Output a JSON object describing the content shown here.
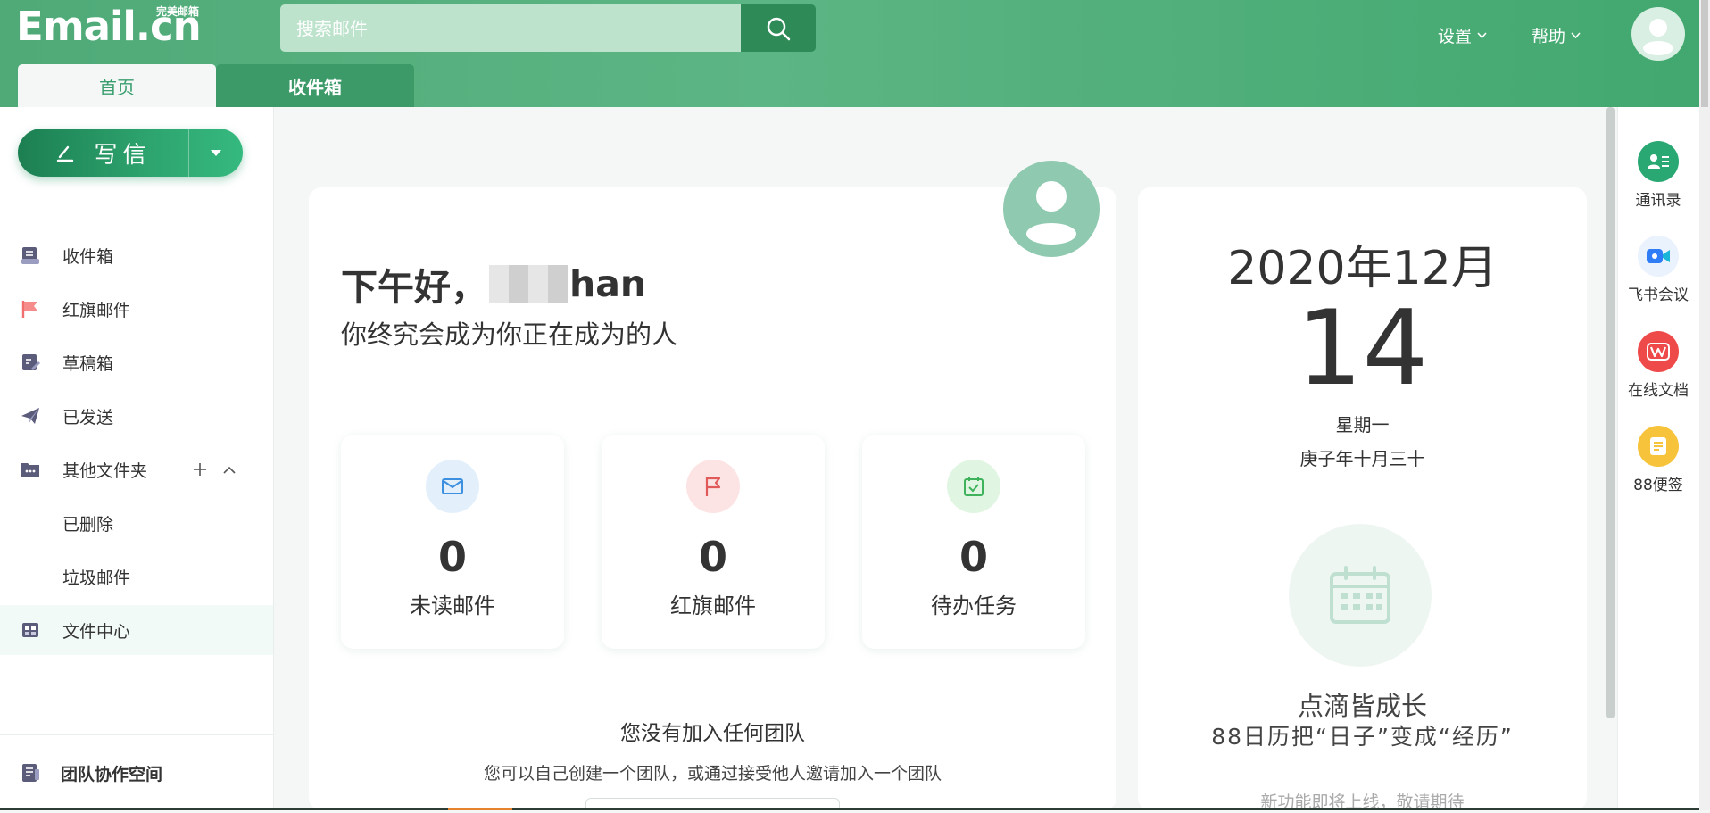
{
  "header": {
    "logo_main": "Email.cn",
    "logo_sub": "完美邮箱",
    "search_placeholder": "搜索邮件",
    "settings_label": "设置",
    "help_label": "帮助",
    "tabs": [
      {
        "label": "首页",
        "active": true
      },
      {
        "label": "收件箱",
        "active": false
      }
    ],
    "colors": {
      "brand": "#4faa78",
      "brand_dark": "#2e8b57"
    }
  },
  "sidebar": {
    "compose_label": "写信",
    "items": [
      {
        "label": "收件箱",
        "icon": "inbox-icon"
      },
      {
        "label": "红旗邮件",
        "icon": "red-flag-icon"
      },
      {
        "label": "草稿箱",
        "icon": "draft-icon"
      },
      {
        "label": "已发送",
        "icon": "send-icon"
      },
      {
        "label": "其他文件夹",
        "icon": "folder-icon"
      },
      {
        "label": "已删除",
        "icon": ""
      },
      {
        "label": "垃圾邮件",
        "icon": ""
      },
      {
        "label": "文件中心",
        "icon": "file-center-icon"
      }
    ],
    "team_space_label": "团队协作空间"
  },
  "main": {
    "greeting_prefix": "下午好，",
    "greeting_suffix": "han",
    "motto": "你终究会成为你正在成为的人",
    "stats": [
      {
        "label": "未读邮件",
        "value": "0",
        "icon": "mail-icon",
        "color": "#3d8fe0",
        "bg": "#e3f0fc"
      },
      {
        "label": "红旗邮件",
        "value": "0",
        "icon": "flag-icon",
        "color": "#e05a5a",
        "bg": "#fde4e4"
      },
      {
        "label": "待办任务",
        "value": "0",
        "icon": "calendar-check-icon",
        "color": "#3fb25c",
        "bg": "#e0f6e2"
      }
    ],
    "team_title": "您没有加入任何团队",
    "team_desc": "您可以自己创建一个团队，或通过接受他人邀请加入一个团队"
  },
  "calendar": {
    "year_month": "2020年12月",
    "day": "14",
    "weekday": "星期一",
    "lunar": "庚子年十月三十",
    "slogan": "点滴皆成长",
    "slogan2": "88日历把“日子”变成“经历”",
    "coming_soon": "新功能即将上线，敬请期待"
  },
  "apps": [
    {
      "label": "通讯录",
      "icon": "contacts-icon",
      "color": "#2aa873"
    },
    {
      "label": "飞书会议",
      "icon": "video-meeting-icon",
      "color": "#2f7df6"
    },
    {
      "label": "在线文档",
      "icon": "wps-doc-icon",
      "color": "#ef4a4a"
    },
    {
      "label": "88便签",
      "icon": "note-icon",
      "color": "#f7c33a"
    }
  ]
}
